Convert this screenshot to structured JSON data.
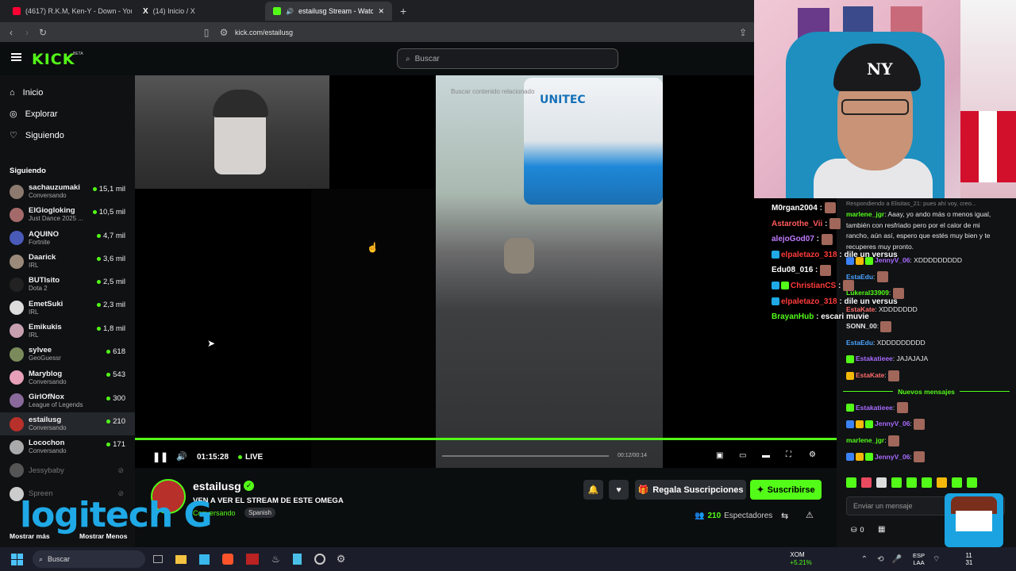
{
  "browser": {
    "tabs": [
      {
        "title": "(4617) R.K.M, Ken-Y - Down - YouTube",
        "icon": "youtube-icon",
        "color": "#ff0033"
      },
      {
        "title": "(14) Inicio / X",
        "icon": "x-icon",
        "color": "#ffffff"
      },
      {
        "title": "estailusg Stream - Watch Live",
        "icon": "kick-icon",
        "color": "#53fc18"
      }
    ],
    "url": "kick.com/estailusg"
  },
  "header": {
    "logo": "KICK",
    "beta": "BETA",
    "search_placeholder": "Buscar"
  },
  "sidebar": {
    "nav": [
      {
        "label": "Inicio",
        "icon": "home-icon"
      },
      {
        "label": "Explorar",
        "icon": "compass-icon"
      },
      {
        "label": "Siguiendo",
        "icon": "heart-icon"
      }
    ],
    "following_title": "Siguiendo",
    "following": [
      {
        "name": "sachauzumaki",
        "category": "Conversando",
        "viewers": "15,1 mil"
      },
      {
        "name": "ElGiogloking",
        "category": "Just Dance 2025 ...",
        "viewers": "10,5 mil"
      },
      {
        "name": "AQUINO",
        "category": "Fortnite",
        "viewers": "4,7 mil"
      },
      {
        "name": "Daarick",
        "category": "IRL",
        "viewers": "3,6 mil"
      },
      {
        "name": "BUTIsito",
        "category": "Dota 2",
        "viewers": "2,5 mil"
      },
      {
        "name": "EmetSuki",
        "category": "IRL",
        "viewers": "2,3 mil"
      },
      {
        "name": "Emikukis",
        "category": "IRL",
        "viewers": "1,8 mil"
      },
      {
        "name": "sylvee",
        "category": "GeoGuessr",
        "viewers": "618"
      },
      {
        "name": "Maryblog",
        "category": "Conversando",
        "viewers": "543"
      },
      {
        "name": "GirlOfNox",
        "category": "League of Legends",
        "viewers": "300"
      },
      {
        "name": "estailusg",
        "category": "Conversando",
        "viewers": "210"
      },
      {
        "name": "Locochon",
        "category": "Conversando",
        "viewers": "171"
      }
    ],
    "offline": [
      "Jessybaby",
      "Spreen"
    ],
    "more": "Mostrar más",
    "less": "Mostrar Menos"
  },
  "player": {
    "time": "01:15:28",
    "live": "LIVE",
    "clip_time": "00:12/00:14",
    "clip_search": "Buscar contenido relacionado",
    "progress": 1.0
  },
  "stream": {
    "channel": "estailusg",
    "title": "VEN A VER EL STREAM DE ESTE OMEGA",
    "category": "Conversando",
    "language": "Spanish",
    "gift_button": "Regala Suscripciones",
    "subscribe_button": "Suscribirse",
    "viewers_count": "210",
    "viewers_label": "Espectadores"
  },
  "chat": {
    "reply_note": "Respondiendo a Elisitas_21: pues ahí voy, creo...",
    "messages": [
      {
        "user": "marlene_jgr",
        "color": "#53fc18",
        "text": "Aaay, yo ando más o menos igual,"
      },
      {
        "user": "",
        "color": "#ffffff",
        "text": "también con resfriado pero por el calor de mi"
      },
      {
        "user": "",
        "color": "#ffffff",
        "text": "rancho, aún así, espero que estés muy bien y te"
      },
      {
        "user": "",
        "color": "#ffffff",
        "text": "recuperes muy pronto."
      },
      {
        "user": "JennyV_06",
        "color": "#a96bff",
        "text": "XDDDDDDDDD"
      },
      {
        "user": "EstaEdu",
        "color": "#4aa3ff",
        "text": ""
      },
      {
        "user": "Lukeral33909",
        "color": "#53fc18",
        "text": ""
      },
      {
        "user": "EstaKate",
        "color": "#ff6b6b",
        "text": "XDDDDDDD"
      },
      {
        "user": "SONN_00",
        "color": "#e6e6e6",
        "text": ""
      },
      {
        "user": "EstaEdu",
        "color": "#4aa3ff",
        "text": "XDDDDDDDDD"
      },
      {
        "user": "Estakatieee",
        "color": "#a96bff",
        "text": "JAJAJAJA"
      },
      {
        "user": "EstaKate",
        "color": "#ff6b6b",
        "text": ""
      }
    ],
    "new_messages": "Nuevos mensajes",
    "after_new": [
      {
        "user": "Estakatieee",
        "color": "#a96bff",
        "text": ""
      },
      {
        "user": "JennyV_06",
        "color": "#a96bff",
        "text": ""
      },
      {
        "user": "marlene_jgr",
        "color": "#53fc18",
        "text": ""
      },
      {
        "user": "JennyV_06",
        "color": "#a96bff",
        "text": ""
      }
    ],
    "input_placeholder": "Enviar un mensaje",
    "points": "0"
  },
  "overlay_chat": [
    {
      "user": "M0rgan2004",
      "color": "#ffffff",
      "text": ""
    },
    {
      "user": "Astarothe_Vii",
      "color": "#ff5a5a",
      "text": ""
    },
    {
      "user": "alejoGod07",
      "color": "#c07bff",
      "text": ""
    },
    {
      "user": "elpaletazo_318",
      "color": "#ff3b3b",
      "text": "dile un versus"
    },
    {
      "user": "Edu08_016",
      "color": "#ffffff",
      "text": ""
    },
    {
      "user": "ChristianCS",
      "color": "#ff3b3b",
      "text": ""
    },
    {
      "user": "elpaletazo_318",
      "color": "#ff3b3b",
      "text": "dile un versus"
    },
    {
      "user": "BrayanHub",
      "color": "#53fc18",
      "text": "escari muvie"
    }
  ],
  "logitech": "logitech G",
  "taskbar": {
    "search": "Buscar",
    "stock_name": "XOM",
    "stock_change": "+5.21%",
    "lang": "ESP",
    "lang2": "LAA",
    "time": "11",
    "date": "31"
  }
}
